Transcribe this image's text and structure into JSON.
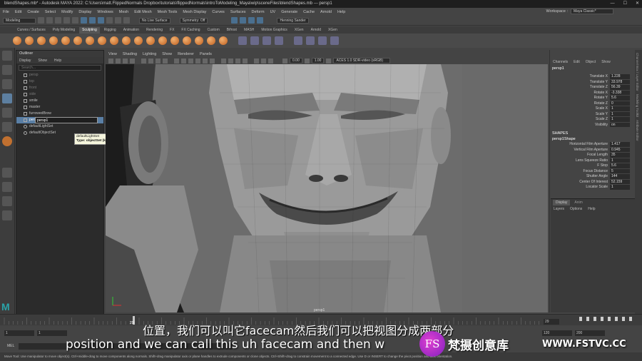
{
  "window": {
    "title": "blendShapes.mb* - Autodesk MAYA 2022: C:\\Users\\matt.FlippedNormals Dropbox\\tutorials\\flippedNormals\\introToModeling_Maya\\wip\\sceneFiles\\blendShapes.mb    ---    persp1"
  },
  "menubar": {
    "items": [
      "File",
      "Edit",
      "Create",
      "Select",
      "Modify",
      "Display",
      "Windows",
      "Mesh",
      "Edit Mesh",
      "Mesh Tools",
      "Mesh Display",
      "Curves",
      "Surfaces",
      "Deform",
      "UV",
      "Generate",
      "Cache",
      "Arnold",
      "Help"
    ],
    "workspace_label": "Workspace :",
    "workspace_value": "Maya Classic*"
  },
  "statusline": {
    "mode": "Modeling",
    "live_surface": "No Live Surface",
    "symmetry": "Symmetry: Off",
    "user": "Henning Sander"
  },
  "shelf": {
    "tabs": [
      "Curves / Surfaces",
      "Poly Modeling",
      "Sculpting",
      "Rigging",
      "Animation",
      "Rendering",
      "FX",
      "FX Caching",
      "Custom",
      "Bifrost",
      "MASH",
      "Motion Graphics",
      "XGen",
      "Arnold",
      "XGen"
    ],
    "active_tab": "Sculpting"
  },
  "outliner": {
    "title": "Outliner",
    "menu": [
      "Display",
      "Show",
      "Help"
    ],
    "search_placeholder": "Search...",
    "items": [
      {
        "label": "persp",
        "dim": true
      },
      {
        "label": "top",
        "dim": true
      },
      {
        "label": "front",
        "dim": true
      },
      {
        "label": "side",
        "dim": true
      },
      {
        "label": "smile",
        "dim": false
      },
      {
        "label": "master",
        "dim": false
      },
      {
        "label": "furrowedBrow",
        "dim": false
      }
    ],
    "selected_item": "persp1",
    "rename_value": "persp1",
    "sets": [
      "defaultLightSet",
      "defaultObjectSet"
    ],
    "tooltip_line1": "defaultLightSet",
    "tooltip_line2": "Type: objectSet (kSet)"
  },
  "viewport": {
    "menu": [
      "View",
      "Shading",
      "Lighting",
      "Show",
      "Renderer",
      "Panels"
    ],
    "value_a": "0.00",
    "value_b": "1.00",
    "colorspace": "ACES 1.0 SDR-video (sRGB)",
    "camera_label": "persp1"
  },
  "channelbox": {
    "menu": [
      "Channels",
      "Edit",
      "Object",
      "Show"
    ],
    "object_name": "persp1",
    "attributes": [
      {
        "name": "Translate X",
        "value": "1.228"
      },
      {
        "name": "Translate Y",
        "value": "33.978"
      },
      {
        "name": "Translate Z",
        "value": "56.39"
      },
      {
        "name": "Rotate X",
        "value": "-3.338"
      },
      {
        "name": "Rotate Y",
        "value": "5.6"
      },
      {
        "name": "Rotate Z",
        "value": "0"
      },
      {
        "name": "Scale X",
        "value": "1"
      },
      {
        "name": "Scale Y",
        "value": "1"
      },
      {
        "name": "Scale Z",
        "value": "1"
      },
      {
        "name": "Visibility",
        "value": "on"
      }
    ],
    "shapes_label": "SHAPES",
    "shape_name": "persp1Shape",
    "shape_attributes": [
      {
        "name": "Horizontal Film Aperture",
        "value": "1.417"
      },
      {
        "name": "Vertical Film Aperture",
        "value": "0.945"
      },
      {
        "name": "Focal Length",
        "value": "35"
      },
      {
        "name": "Lens Squeeze Ratio",
        "value": "1"
      },
      {
        "name": "F Stop",
        "value": "5.6"
      },
      {
        "name": "Focus Distance",
        "value": "5"
      },
      {
        "name": "Shutter Angle",
        "value": "144"
      },
      {
        "name": "Center Of Interest",
        "value": "52.159"
      },
      {
        "name": "Locator Scale",
        "value": "1"
      }
    ],
    "side_tabs": [
      "Channel Box / Layer Editor",
      "Modeling Toolkit",
      "Attribute Editor"
    ]
  },
  "layer_editor": {
    "tabs": [
      "Display",
      "Anim"
    ],
    "menu": [
      "Layers",
      "Options",
      "Help"
    ]
  },
  "timeline": {
    "current_frame": "29",
    "end_field": "29",
    "range_start": "1",
    "range_start2": "1",
    "range_end": "120",
    "range_end2": "200"
  },
  "mel": {
    "label": "MEL",
    "helpline": "Move Tool: Use manipulator to move object(s). Ctrl+middle-drag to move components along normals. Shift+drag manipulator axis or plane handles to extrude components or clone objects. Ctrl+Shift+drag to constrain movement to a connected edge. Use D or INSERT to change the pivot position and axis orientation."
  },
  "subtitles": {
    "zh": "位置，我们可以叫它facecam然后我们可以把视图分成两部分",
    "en": "position and we can call this uh facecam and then w"
  },
  "watermark": {
    "logo": "FS",
    "text": "梵摄创意库",
    "url": "WWW.FSTVC.CC"
  }
}
